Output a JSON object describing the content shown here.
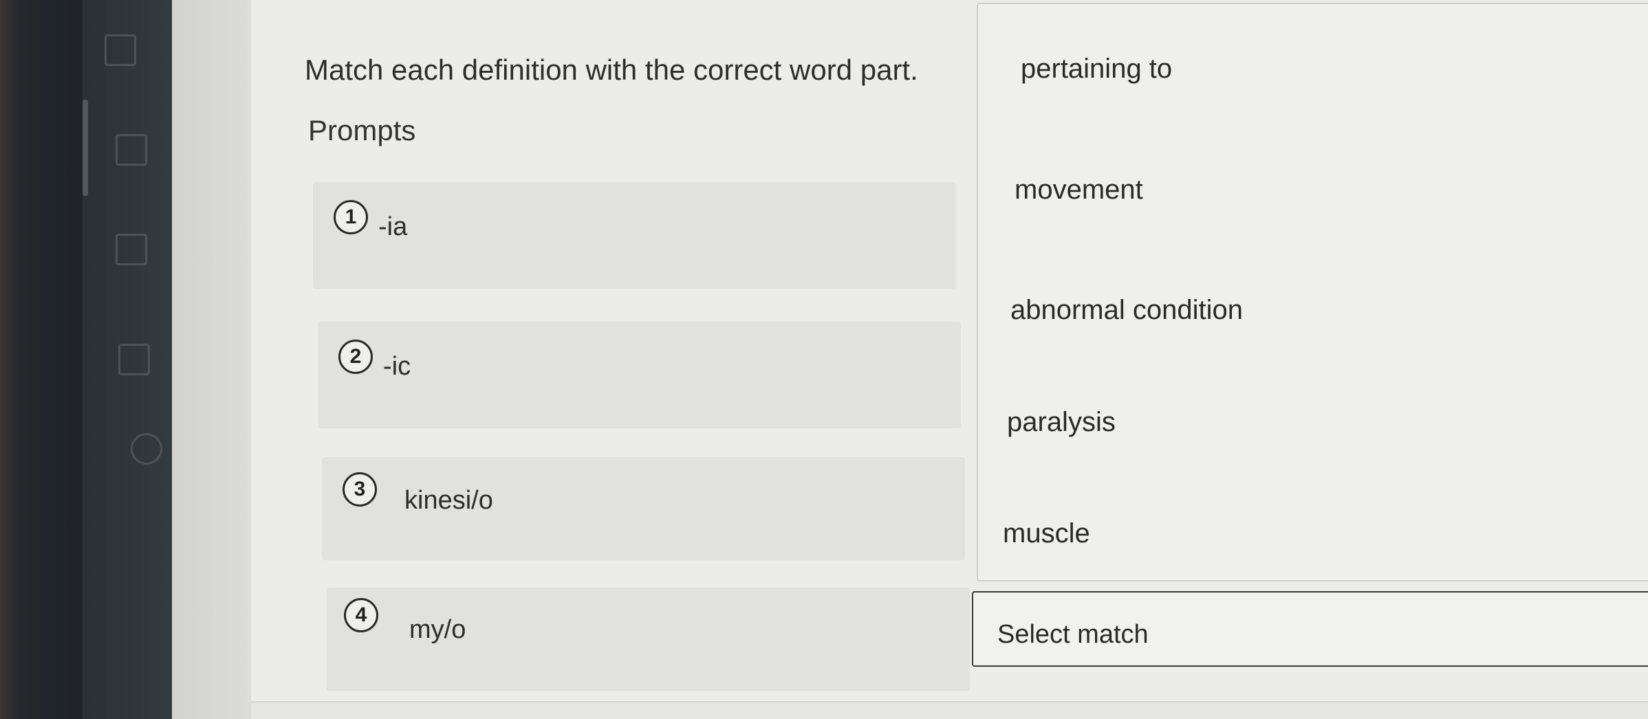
{
  "question": {
    "instruction": "Match each definition with the correct word part.",
    "prompts_heading": "Prompts"
  },
  "prompts": [
    {
      "number": "1",
      "part": "-ia"
    },
    {
      "number": "2",
      "part": "-ic"
    },
    {
      "number": "3",
      "part": "kinesi/o"
    },
    {
      "number": "4",
      "part": "my/o"
    }
  ],
  "choices": [
    "pertaining to",
    "movement",
    "abnormal condition",
    "paralysis",
    "muscle"
  ],
  "select_match": {
    "label": "Select match"
  }
}
